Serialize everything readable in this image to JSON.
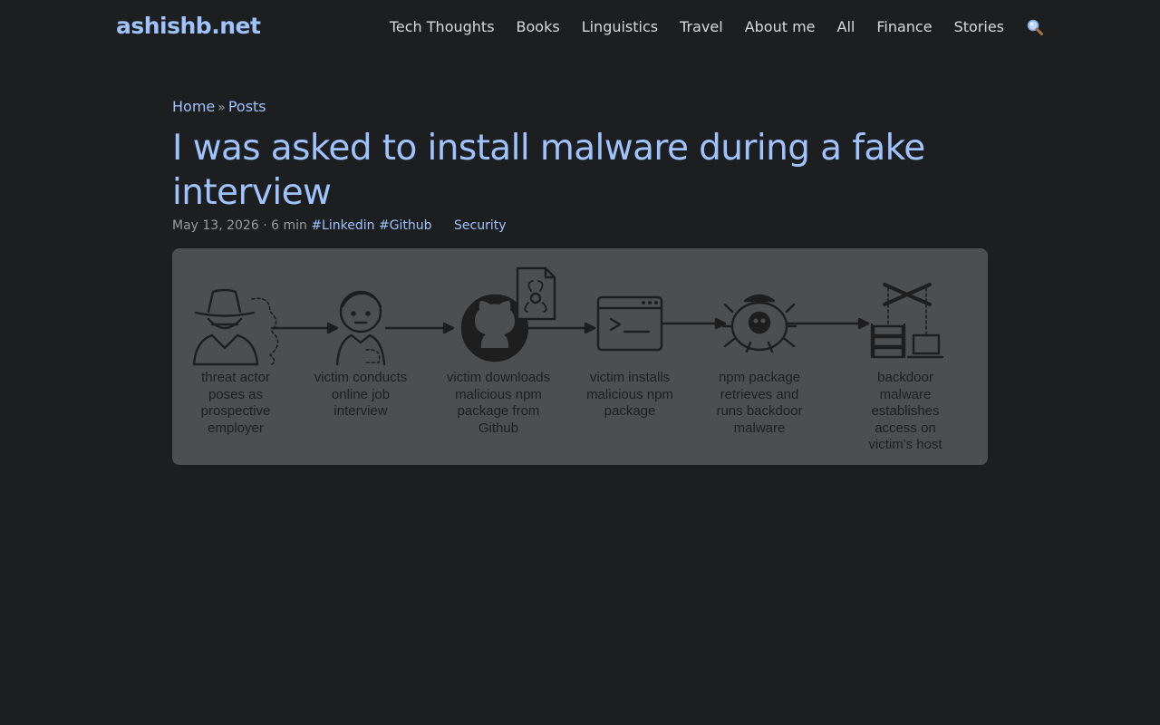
{
  "site": {
    "logo": "ashishb.net"
  },
  "nav": {
    "items": [
      "Tech Thoughts",
      "Books",
      "Linguistics",
      "Travel",
      "About me",
      "All",
      "Finance",
      "Stories"
    ],
    "search_icon": "search-icon"
  },
  "breadcrumb": {
    "home": "Home",
    "separator": "»",
    "posts": "Posts"
  },
  "post": {
    "title": "I was asked to install malware during a fake interview",
    "date": "May 13, 2026",
    "dot": "·",
    "read_time": "6 min",
    "tags": [
      "#Linkedin",
      "#Github"
    ],
    "category": "Security"
  },
  "cover": {
    "steps": [
      {
        "icon": "spy-icon",
        "label": "threat actor poses as prospective employer"
      },
      {
        "icon": "person-icon",
        "label": "victim conducts online job interview"
      },
      {
        "icon": "github-icon",
        "label": "victim downloads malicious npm package from Github"
      },
      {
        "icon": "terminal-icon",
        "label": "victim installs malicious npm package"
      },
      {
        "icon": "skull-bug-icon",
        "label": "npm package retrieves and runs backdoor malware"
      },
      {
        "icon": "server-laptop-icon",
        "label": "backdoor malware establishes access on victim's host"
      }
    ]
  },
  "colors": {
    "background": "#1d1e20",
    "accent": "#9fc3ff",
    "text": "#dadadb",
    "muted": "#9b9c9d",
    "cover_bg": "#4d4e50"
  }
}
